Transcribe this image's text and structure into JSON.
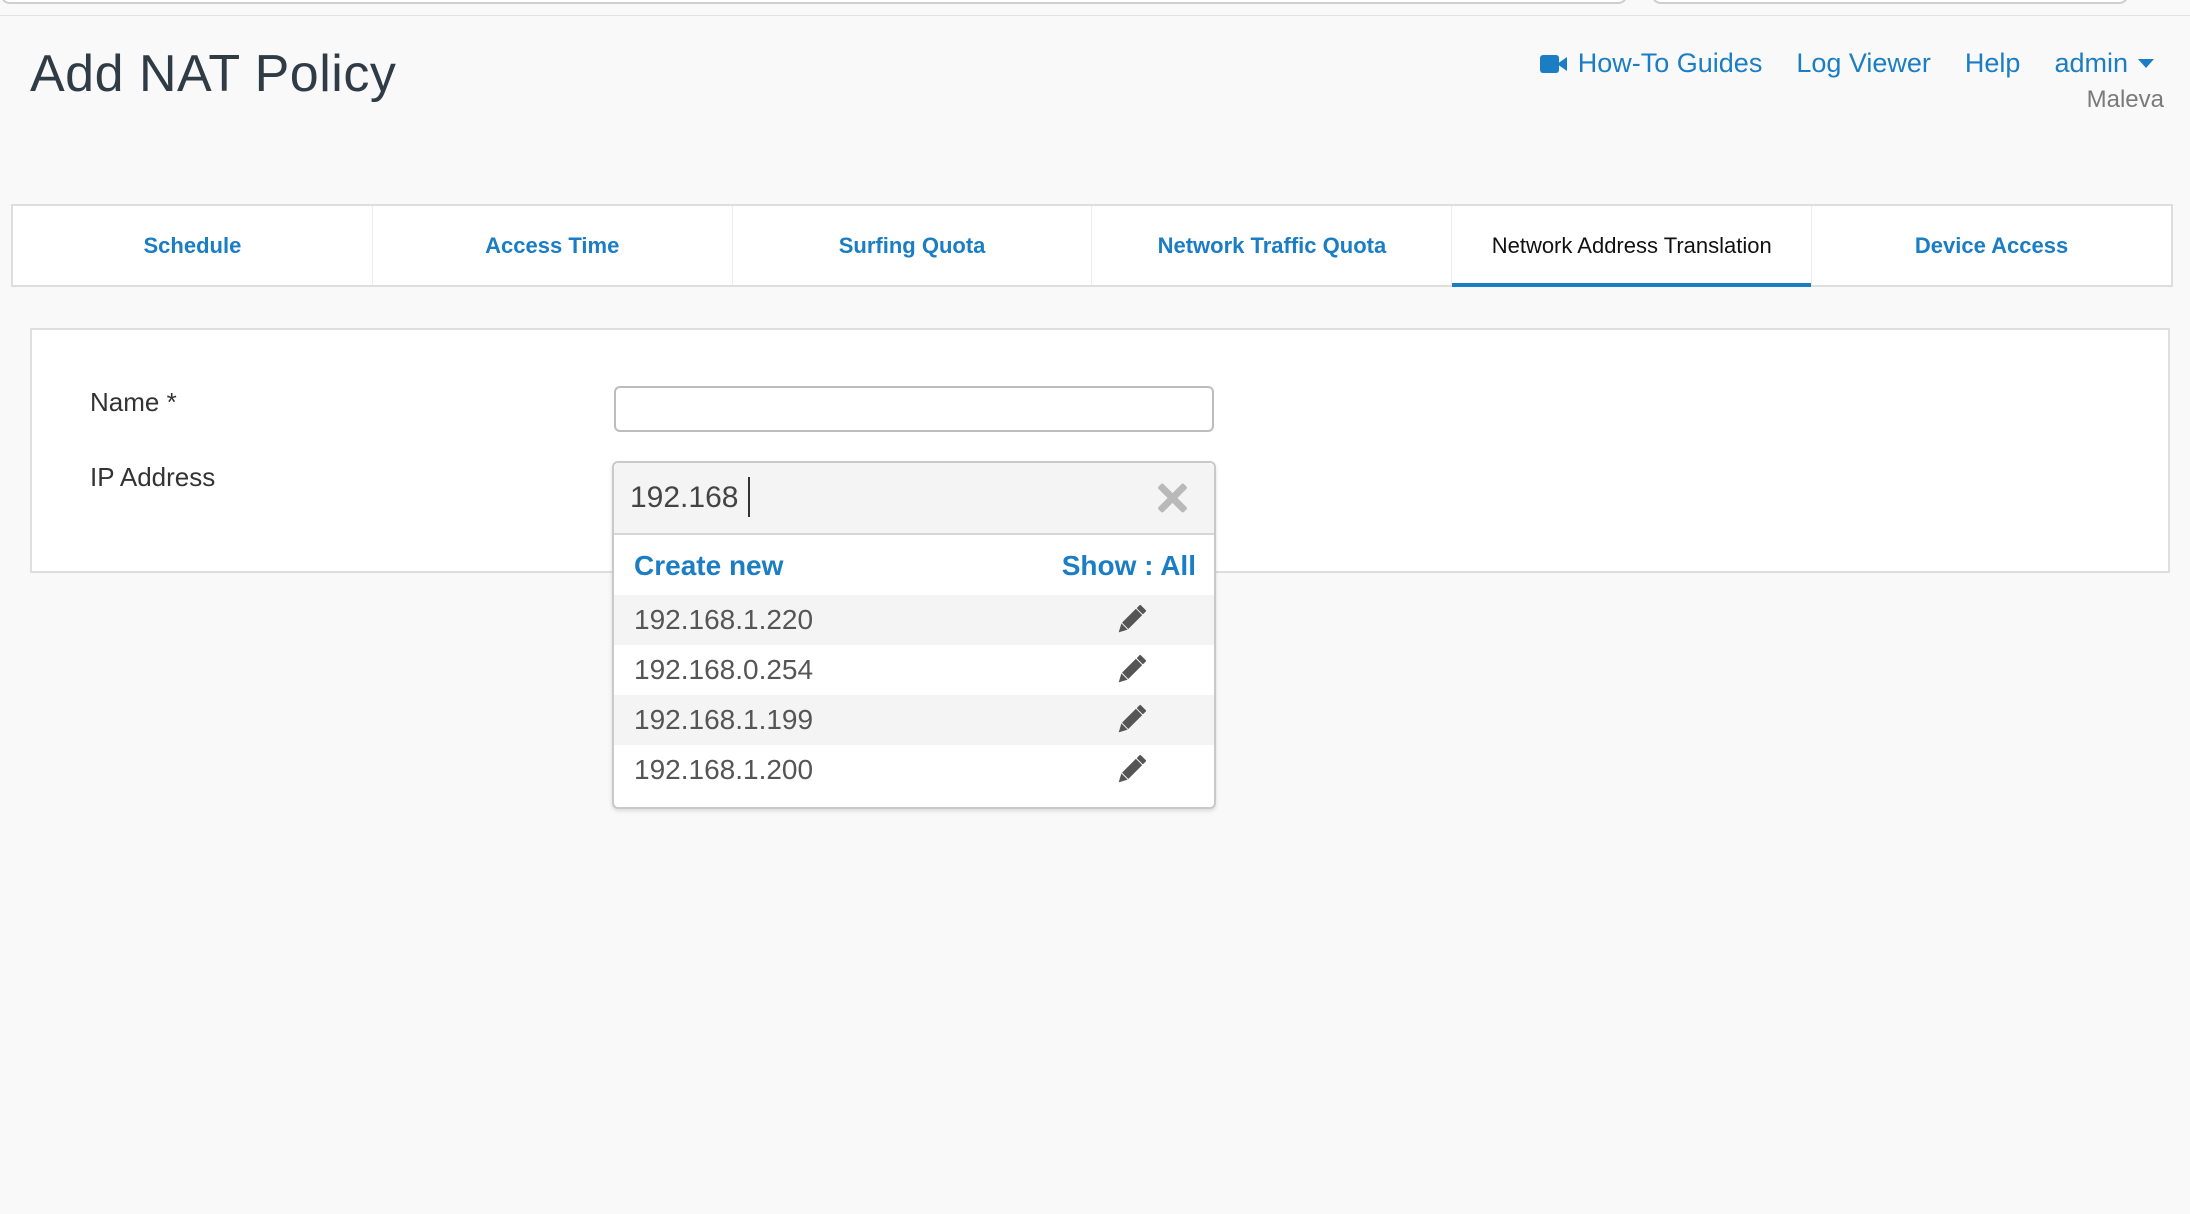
{
  "page": {
    "title": "Add NAT Policy"
  },
  "header": {
    "links": {
      "guides": "How-To Guides",
      "log_viewer": "Log Viewer",
      "help": "Help",
      "user": "admin"
    },
    "user_org": "Maleva",
    "icons": {
      "guides": "video-camera-icon",
      "user_menu": "caret-down-icon"
    }
  },
  "tabs": [
    {
      "label": "Schedule",
      "active": false
    },
    {
      "label": "Access Time",
      "active": false
    },
    {
      "label": "Surfing Quota",
      "active": false
    },
    {
      "label": "Network Traffic Quota",
      "active": false
    },
    {
      "label": "Network Address Translation",
      "active": true
    },
    {
      "label": "Device Access",
      "active": false
    }
  ],
  "form": {
    "name_label": "Name *",
    "name_value": "",
    "ip_label": "IP Address"
  },
  "ip_dropdown": {
    "search_value": "192.168",
    "create_new": "Create new",
    "show_filter": "Show : All",
    "options": [
      "192.168.1.220",
      "192.168.0.254",
      "192.168.1.199",
      "192.168.1.200"
    ],
    "icons": {
      "clear": "close-icon",
      "edit": "pencil-icon"
    }
  },
  "colors": {
    "accent": "#1b7dc3",
    "title": "#2f3b45",
    "background": "#f9f9f9"
  }
}
